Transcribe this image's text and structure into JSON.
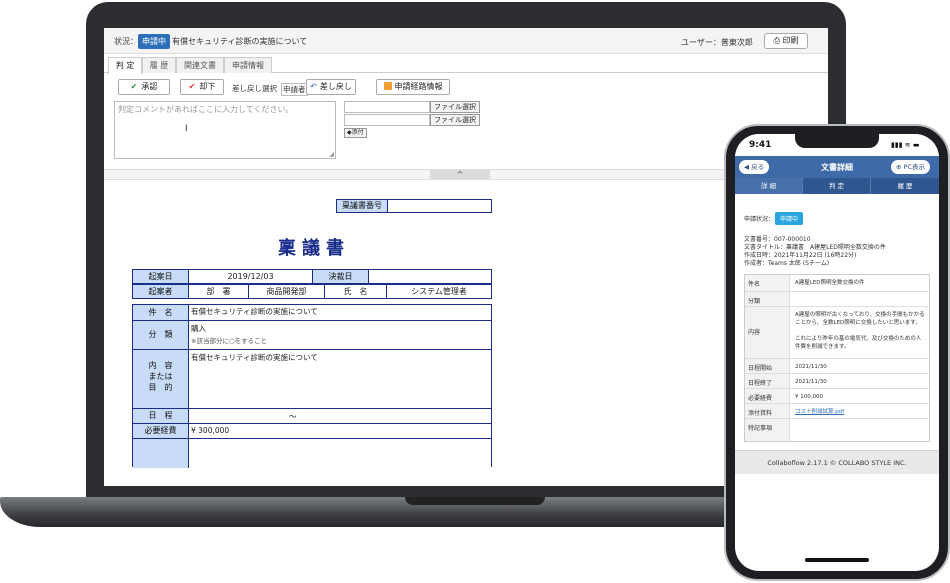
{
  "laptop": {
    "topbar": {
      "status_label": "状況：",
      "status_badge": "申請中",
      "doc_title": "有償セキュリティ診断の実施について",
      "user": "ユーザー：普東次郎",
      "print_label": "印刷"
    },
    "tabs": [
      "判 定",
      "履 歴",
      "関連文書",
      "申請情報"
    ],
    "actions": {
      "approve": "承認",
      "reject": "却下",
      "sendback_select": "差し戻し選択",
      "applicant": "申請者",
      "sendback": "差し戻し",
      "route_info": "申請経路情報"
    },
    "comment_placeholder": "判定コメントがあればここに入力してください。",
    "file_select": "ファイル選択",
    "attach_label": "◆添付",
    "collapse_icon": "^",
    "form": {
      "number_label": "稟議書番号",
      "title": "稟議書",
      "row1": {
        "h1": "起案日",
        "v1": "2019/12/03",
        "h2": "決裁日",
        "v2": ""
      },
      "row2": {
        "h1": "起案者",
        "c1": "部　署",
        "v1": "商品開発部",
        "c2": "氏　名",
        "v2": "システム管理者"
      },
      "subject_label": "件　名",
      "subject_value": "有償セキュリティ診断の実施について",
      "category_label": "分　類",
      "category_value": "購入",
      "category_note": "※該当部分に○をすること",
      "content_label": "内　容\nまたは\n目　的",
      "content_value": "有償セキュリティ診断の実施について",
      "schedule_label": "日　程",
      "schedule_value": "～",
      "cost_label": "必要経費",
      "cost_value": "¥ 300,000"
    }
  },
  "phone": {
    "time": "9:41",
    "signal": "▮▮▮ ≋ ▬",
    "back_label": "戻る",
    "title": "文書詳細",
    "pc_label": "PC表示",
    "tabs": [
      "詳 細",
      "判 定",
      "履 歴"
    ],
    "status_label": "申請状況：",
    "status_badge": "申請中",
    "doc_number": "文書番号：007-000010",
    "doc_title": "文書タイトル：稟議書　A建屋LED照明全数交換の件",
    "created": "作成日時：2021年11月22日 (16時22分)",
    "author": "作成者：Teams 太郎 (Sチーム)",
    "rows": [
      {
        "label": "件名",
        "value": "A建屋LED照明全数交換の件"
      },
      {
        "label": "分類",
        "value": ""
      },
      {
        "label": "内容",
        "value": "A建屋の照明が古くなっており、交換の手間もかかることから、全数LED照明に交換したいと思います。\n\nこれにより昨年の基の電気代、及び交換のための人件費を削減できます。"
      },
      {
        "label": "日程開始",
        "value": "2021/11/30"
      },
      {
        "label": "日程終了",
        "value": "2021/11/30"
      },
      {
        "label": "必要経費",
        "value": "¥ 100,000"
      },
      {
        "label": "添付資料",
        "value": "コスト削減試算.pdf"
      },
      {
        "label": "特記事項",
        "value": ""
      }
    ],
    "footer": "Collaboflow 2.17.1 © COLLABO STYLE INC."
  }
}
